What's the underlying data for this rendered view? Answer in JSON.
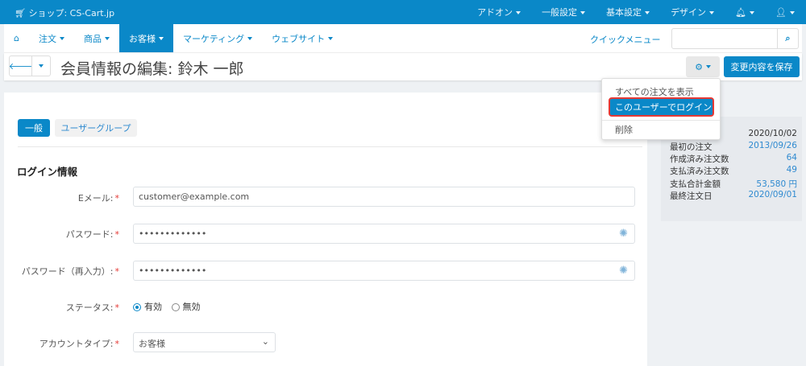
{
  "topbar": {
    "shop": "ショップ: CS-Cart.jp",
    "menus": [
      "アドオン",
      "一般設定",
      "基本設定",
      "デザイン"
    ]
  },
  "nav": {
    "items": [
      "注文",
      "商品",
      "お客様",
      "マーケティング",
      "ウェブサイト"
    ],
    "quick_menu": "クイックメニュー",
    "search_placeholder": ""
  },
  "header": {
    "title": "会員情報の編集: 鈴木 一郎",
    "save": "変更内容を保存"
  },
  "dropdown": {
    "items": [
      "すべての注文を表示",
      "このユーザーでログイン",
      "削除"
    ]
  },
  "tabs": [
    "一般",
    "ユーザーグループ"
  ],
  "form": {
    "section": "ログイン情報",
    "email_label": "Eメール:",
    "email": "customer@example.com",
    "password_label": "パスワード:",
    "password": "•••••••••••••",
    "password2_label": "パスワード（再入力）:",
    "password2": "•••••••••••••",
    "status_label": "ステータス:",
    "status_active": "有効",
    "status_inactive": "無効",
    "account_label": "アカウントタイプ:",
    "account": "お客様",
    "required": "*"
  },
  "sidebar": {
    "rows": [
      {
        "label": "",
        "value": "2020/10/02"
      },
      {
        "label": "最初の注文",
        "value": "2013/09/26"
      },
      {
        "label": "作成済み注文数",
        "value": "64"
      },
      {
        "label": "支払済み注文数",
        "value": "49"
      },
      {
        "label": "支払合計金額",
        "value": "53,580 円"
      },
      {
        "label": "最終注文日",
        "value": "2020/09/01"
      }
    ]
  }
}
